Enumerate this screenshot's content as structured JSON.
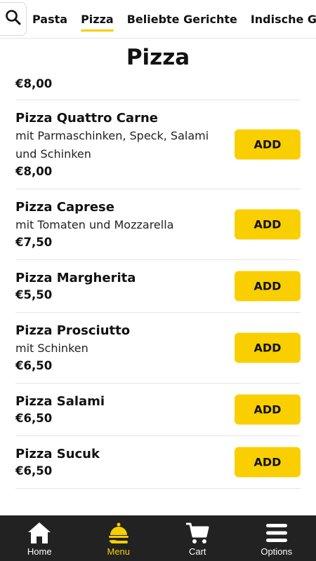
{
  "categories": {
    "tabs": [
      {
        "label": "Pasta"
      },
      {
        "label": "Pizza"
      },
      {
        "label": "Beliebte Gerichte"
      },
      {
        "label": "Indische Gerichte"
      }
    ],
    "active_tab": "Pizza",
    "search_icon": "search-icon"
  },
  "section": {
    "title": "Pizza"
  },
  "menu": {
    "add_label": "ADD",
    "items": [
      {
        "name": "",
        "description": "",
        "price": "€8,00"
      },
      {
        "name": "Pizza Quattro Carne",
        "description": "mit Parmaschinken, Speck, Salami und Schinken",
        "price": "€8,00"
      },
      {
        "name": "Pizza Caprese",
        "description": "mit Tomaten und Mozzarella",
        "price": "€7,50"
      },
      {
        "name": "Pizza Margherita",
        "description": "",
        "price": "€5,50"
      },
      {
        "name": "Pizza Prosciutto",
        "description": "mit Schinken",
        "price": "€6,50"
      },
      {
        "name": "Pizza Salami",
        "description": "",
        "price": "€6,50"
      },
      {
        "name": "Pizza Sucuk",
        "description": "",
        "price": "€6,50"
      }
    ]
  },
  "bottom_nav": {
    "items": [
      {
        "label": "Home",
        "icon": "home-icon"
      },
      {
        "label": "Menu",
        "icon": "menu-cloche-icon"
      },
      {
        "label": "Cart",
        "icon": "cart-icon"
      },
      {
        "label": "Options",
        "icon": "hamburger-icon"
      }
    ],
    "active": "Menu"
  },
  "colors": {
    "accent": "#f9cf00",
    "nav_background": "#222222",
    "divider": "#e5e5e5"
  }
}
